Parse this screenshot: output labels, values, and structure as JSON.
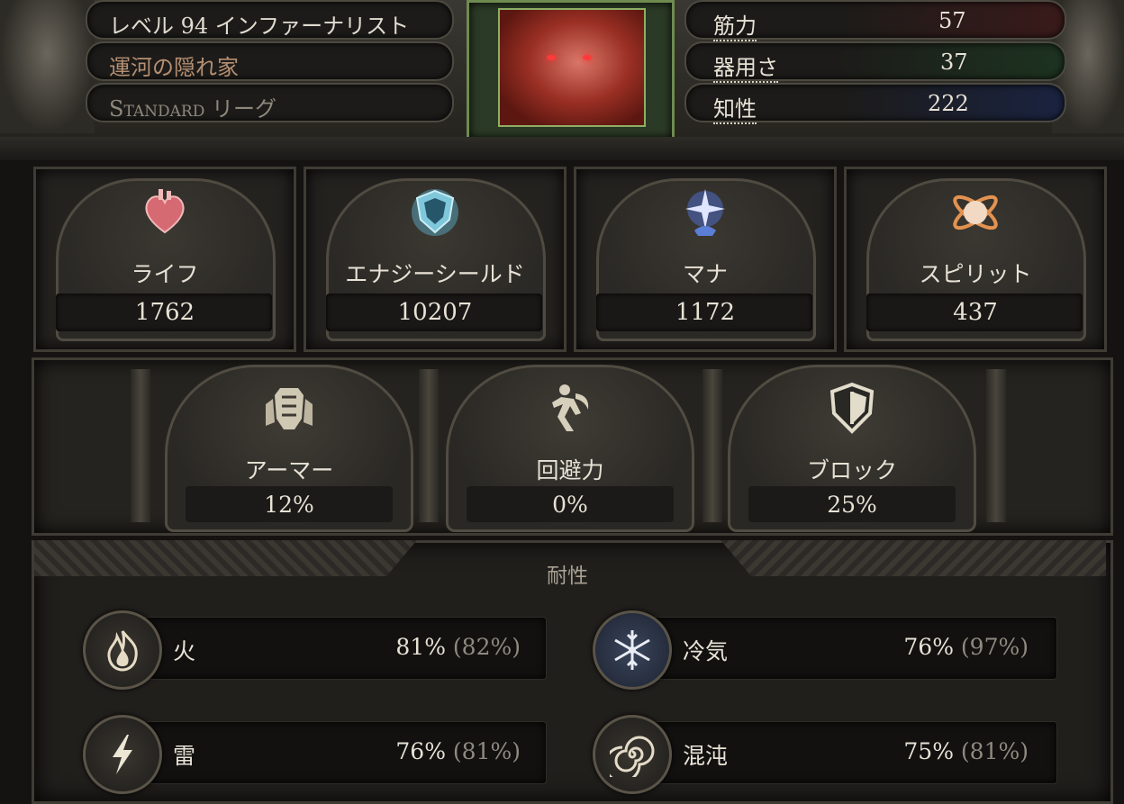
{
  "header": {
    "level_text": "レベル 94 インファーナリスト",
    "character_name": "運河の隠れ家",
    "league": "Standard リーグ",
    "attributes": [
      {
        "label": "筋力",
        "value": "57"
      },
      {
        "label": "器用さ",
        "value": "37"
      },
      {
        "label": "知性",
        "value": "222"
      }
    ]
  },
  "pools": [
    {
      "label": "ライフ",
      "value": "1762",
      "icon": "heart-icon"
    },
    {
      "label": "エナジーシールド",
      "value": "10207",
      "icon": "shield-icon"
    },
    {
      "label": "マナ",
      "value": "1172",
      "icon": "mana-icon"
    },
    {
      "label": "スピリット",
      "value": "437",
      "icon": "spirit-orb-icon"
    }
  ],
  "defences": [
    {
      "label": "アーマー",
      "value": "12%",
      "icon": "armour-icon"
    },
    {
      "label": "回避力",
      "value": "0%",
      "icon": "evasion-icon"
    },
    {
      "label": "ブロック",
      "value": "25%",
      "icon": "block-shield-icon"
    }
  ],
  "resistances": {
    "title": "耐性",
    "items": [
      {
        "label": "火",
        "value": "81%",
        "max": "(82%)",
        "icon": "fire-icon"
      },
      {
        "label": "冷気",
        "value": "76%",
        "max": "(97%)",
        "icon": "snowflake-icon"
      },
      {
        "label": "雷",
        "value": "76%",
        "max": "(81%)",
        "icon": "lightning-icon"
      },
      {
        "label": "混沌",
        "value": "75%",
        "max": "(81%)",
        "icon": "chaos-spiral-icon"
      }
    ]
  }
}
